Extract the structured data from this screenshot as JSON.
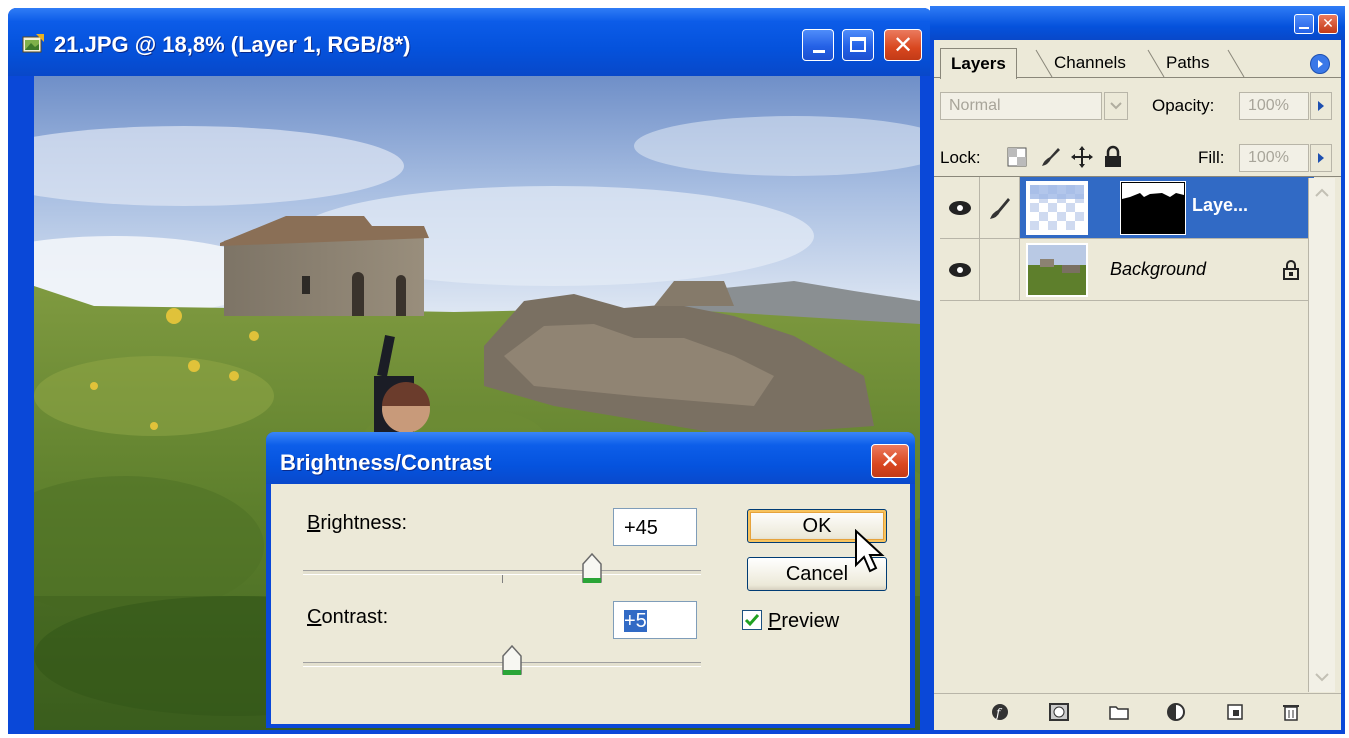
{
  "document_window": {
    "title": "21.JPG @ 18,8% (Layer 1, RGB/8*)"
  },
  "dialog": {
    "title": "Brightness/Contrast",
    "brightness": {
      "label_accel": "B",
      "label_rest": "rightness:",
      "value": "+45",
      "level": 45
    },
    "contrast": {
      "label_accel": "C",
      "label_rest": "ontrast:",
      "value": "+5",
      "level": 5
    },
    "ok_label": "OK",
    "cancel_label": "Cancel",
    "preview": {
      "label_accel": "P",
      "label_rest": "review",
      "checked": true
    }
  },
  "layers_panel": {
    "tabs": [
      {
        "label": "Layers",
        "active": true
      },
      {
        "label": "Channels",
        "active": false
      },
      {
        "label": "Paths",
        "active": false
      }
    ],
    "blend_mode": "Normal",
    "opacity_label": "Opacity:",
    "opacity_value": "100%",
    "lock_label": "Lock:",
    "fill_label": "Fill:",
    "fill_value": "100%",
    "layers": [
      {
        "name": "Laye...",
        "selected": true,
        "visible": true,
        "has_mask": true
      },
      {
        "name": "Background",
        "selected": false,
        "visible": true,
        "locked": true
      }
    ]
  },
  "colors": {
    "xp_title_blue": "#0552dc",
    "xp_face": "#ece9d8",
    "selection_blue": "#316ac5"
  }
}
